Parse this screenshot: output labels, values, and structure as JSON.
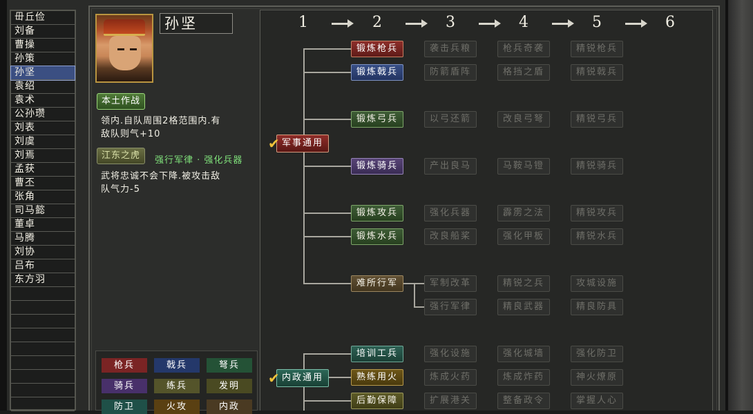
{
  "officers": [
    "毌丘俭",
    "刘备",
    "曹操",
    "孙策",
    "孙坚",
    "袁绍",
    "袁术",
    "公孙瓒",
    "刘表",
    "刘虞",
    "刘焉",
    "孟获",
    "曹丕",
    "张角",
    "司马懿",
    "董卓",
    "马腾",
    "刘协",
    "吕布",
    "东方羽"
  ],
  "selected_officer": "孙坚",
  "officer_name": "孙坚",
  "skill1": {
    "name": "本土作战",
    "desc1": "领内.自队周围2格范围内.有",
    "desc2": "敌队则气+10"
  },
  "skill2": {
    "name": "江东之虎",
    "effects": "强行军律 · 强化兵器",
    "desc1": "武将忠诚不会下降.被攻击敌",
    "desc2": "队气力-5"
  },
  "units": [
    "枪兵",
    "戟兵",
    "弩兵",
    "骑兵",
    "练兵",
    "发明",
    "防卫",
    "火攻",
    "内政"
  ],
  "columns": [
    "1",
    "2",
    "3",
    "4",
    "5",
    "6"
  ],
  "roots": {
    "military": "军事通用",
    "civil": "内政通用"
  },
  "tree": [
    [
      "锻炼枪兵",
      "袭击兵粮",
      "枪兵奇袭",
      "精锐枪兵"
    ],
    [
      "锻炼戟兵",
      "防箭盾阵",
      "格挡之盾",
      "精锐戟兵"
    ],
    [
      "锻炼弓兵",
      "以弓还箭",
      "改良弓弩",
      "精锐弓兵"
    ],
    [
      "锻炼骑兵",
      "产出良马",
      "马鞍马镫",
      "精锐骑兵"
    ],
    [
      "锻炼攻兵",
      "强化兵器",
      "霹雳之法",
      "精锐攻兵"
    ],
    [
      "锻炼水兵",
      "改良船桨",
      "强化甲板",
      "精锐水兵"
    ],
    [
      "难所行军",
      "军制改革",
      "精锐之兵",
      "攻城设施"
    ],
    [
      "",
      "强行军律",
      "精良武器",
      "精良防具"
    ],
    [
      "培训工兵",
      "强化设施",
      "强化城墙",
      "强化防卫"
    ],
    [
      "熟练用火",
      "炼成火药",
      "炼成炸药",
      "神火燎原"
    ],
    [
      "后勤保障",
      "扩展港关",
      "整备政令",
      "掌握人心"
    ]
  ]
}
